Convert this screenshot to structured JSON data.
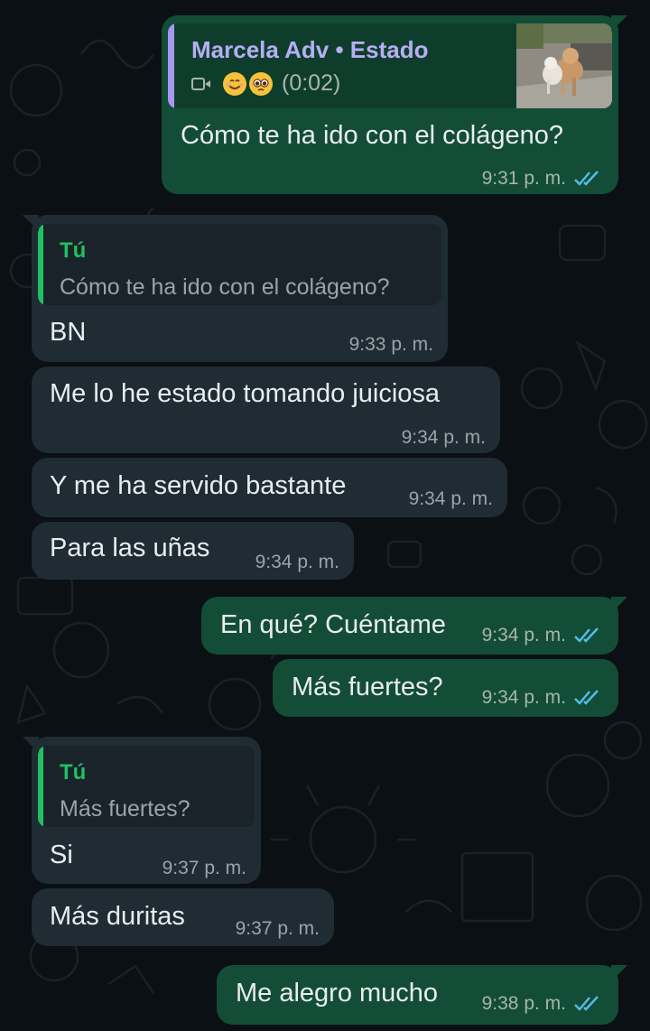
{
  "theme": {
    "background": "#0b1014",
    "outgoing_bubble": "#134d37",
    "incoming_bubble": "#1f2c33",
    "read_ticks": "#53bdeb",
    "reply_accent": "#21c063",
    "status_accent": "#a797f2"
  },
  "status_reply": {
    "name": "Marcela Adv",
    "separator": " • ",
    "type": "Estado",
    "video_icon": "video-camera-icon",
    "emojis": [
      "smiling-face-emoji",
      "pleading-face-emoji"
    ],
    "duration": "(0:02)",
    "thumbnail": "dogs-photo-thumbnail"
  },
  "messages": [
    {
      "text": "Cómo te ha ido con el colágeno?",
      "time": "9:31 p. m.",
      "dir": "out",
      "status": "read"
    },
    {
      "text": "BN",
      "time": "9:33 p. m.",
      "dir": "in",
      "quote_author": "Tú",
      "quote_text": "Cómo te ha ido con el colágeno?"
    },
    {
      "text": "Me lo he estado tomando juiciosa",
      "time": "9:34 p. m.",
      "dir": "in"
    },
    {
      "text": "Y me ha servido bastante",
      "time": "9:34 p. m.",
      "dir": "in"
    },
    {
      "text": "Para las uñas",
      "time": "9:34 p. m.",
      "dir": "in"
    },
    {
      "text": "En qué? Cuéntame",
      "time": "9:34 p. m.",
      "dir": "out",
      "status": "read"
    },
    {
      "text": "Más fuertes?",
      "time": "9:34 p. m.",
      "dir": "out",
      "status": "read"
    },
    {
      "text": "Si",
      "time": "9:37 p. m.",
      "dir": "in",
      "quote_author": "Tú",
      "quote_text": "Más fuertes?"
    },
    {
      "text": "Más duritas",
      "time": "9:37 p. m.",
      "dir": "in"
    },
    {
      "text": "Me alegro mucho",
      "time": "9:38 p. m.",
      "dir": "out",
      "status": "read"
    }
  ]
}
